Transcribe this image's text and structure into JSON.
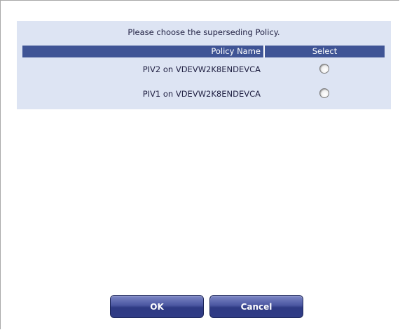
{
  "dialog": {
    "prompt": "Please choose the superseding Policy.",
    "table": {
      "columns": [
        "Policy Name",
        "Select"
      ],
      "rows": [
        {
          "policy_name": "PIV2 on VDEVW2K8ENDEVCA",
          "selected": false
        },
        {
          "policy_name": "PIV1 on VDEVW2K8ENDEVCA",
          "selected": false
        }
      ]
    },
    "buttons": {
      "ok_label": "OK",
      "cancel_label": "Cancel"
    }
  },
  "colors": {
    "panel_background": "#dde4f3",
    "header_background": "#3f5495",
    "button_gradient_top": "#7d87c6",
    "button_gradient_bottom": "#303c86"
  }
}
